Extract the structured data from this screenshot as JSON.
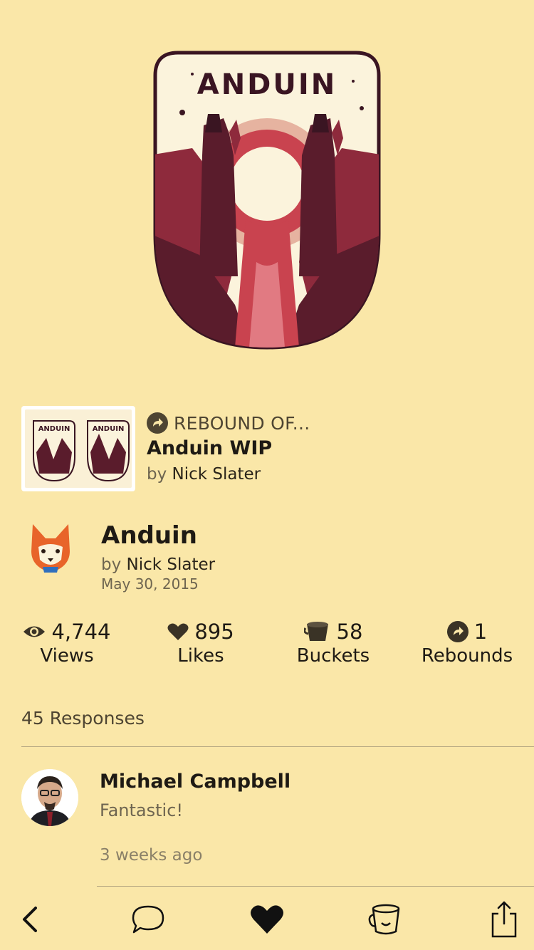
{
  "hero": {
    "logo_text": "ANDUIN"
  },
  "rebound": {
    "label": "REBOUND OF...",
    "title": "Anduin WIP",
    "by_prefix": "by",
    "author": "Nick Slater",
    "thumb_text_left": "ANDUIN",
    "thumb_text_right": "ANDUIN"
  },
  "shot": {
    "title": "Anduin",
    "by_prefix": "by",
    "author": "Nick Slater",
    "date": "May 30, 2015"
  },
  "stats": [
    {
      "icon": "eye-icon",
      "value": "4,744",
      "label": "Views"
    },
    {
      "icon": "heart-icon",
      "value": "895",
      "label": "Likes"
    },
    {
      "icon": "bucket-icon",
      "value": "58",
      "label": "Buckets"
    },
    {
      "icon": "rebound-icon",
      "value": "1",
      "label": "Rebounds"
    }
  ],
  "responses": {
    "count_label": "45 Responses",
    "items": [
      {
        "author": "Michael Campbell",
        "body": "Fantastic!",
        "time": "3 weeks ago"
      }
    ]
  },
  "toolbar": {
    "items": [
      "back-icon",
      "comment-icon",
      "heart-icon",
      "bucket-icon",
      "share-icon"
    ]
  },
  "colors": {
    "background": "#fae7a8",
    "ink": "#1e1a14",
    "muted": "#6e6550",
    "artwork_dark": "#3a1522",
    "artwork_red": "#c9434f",
    "artwork_pink": "#e6b3a0",
    "fox_orange": "#e8642a"
  }
}
